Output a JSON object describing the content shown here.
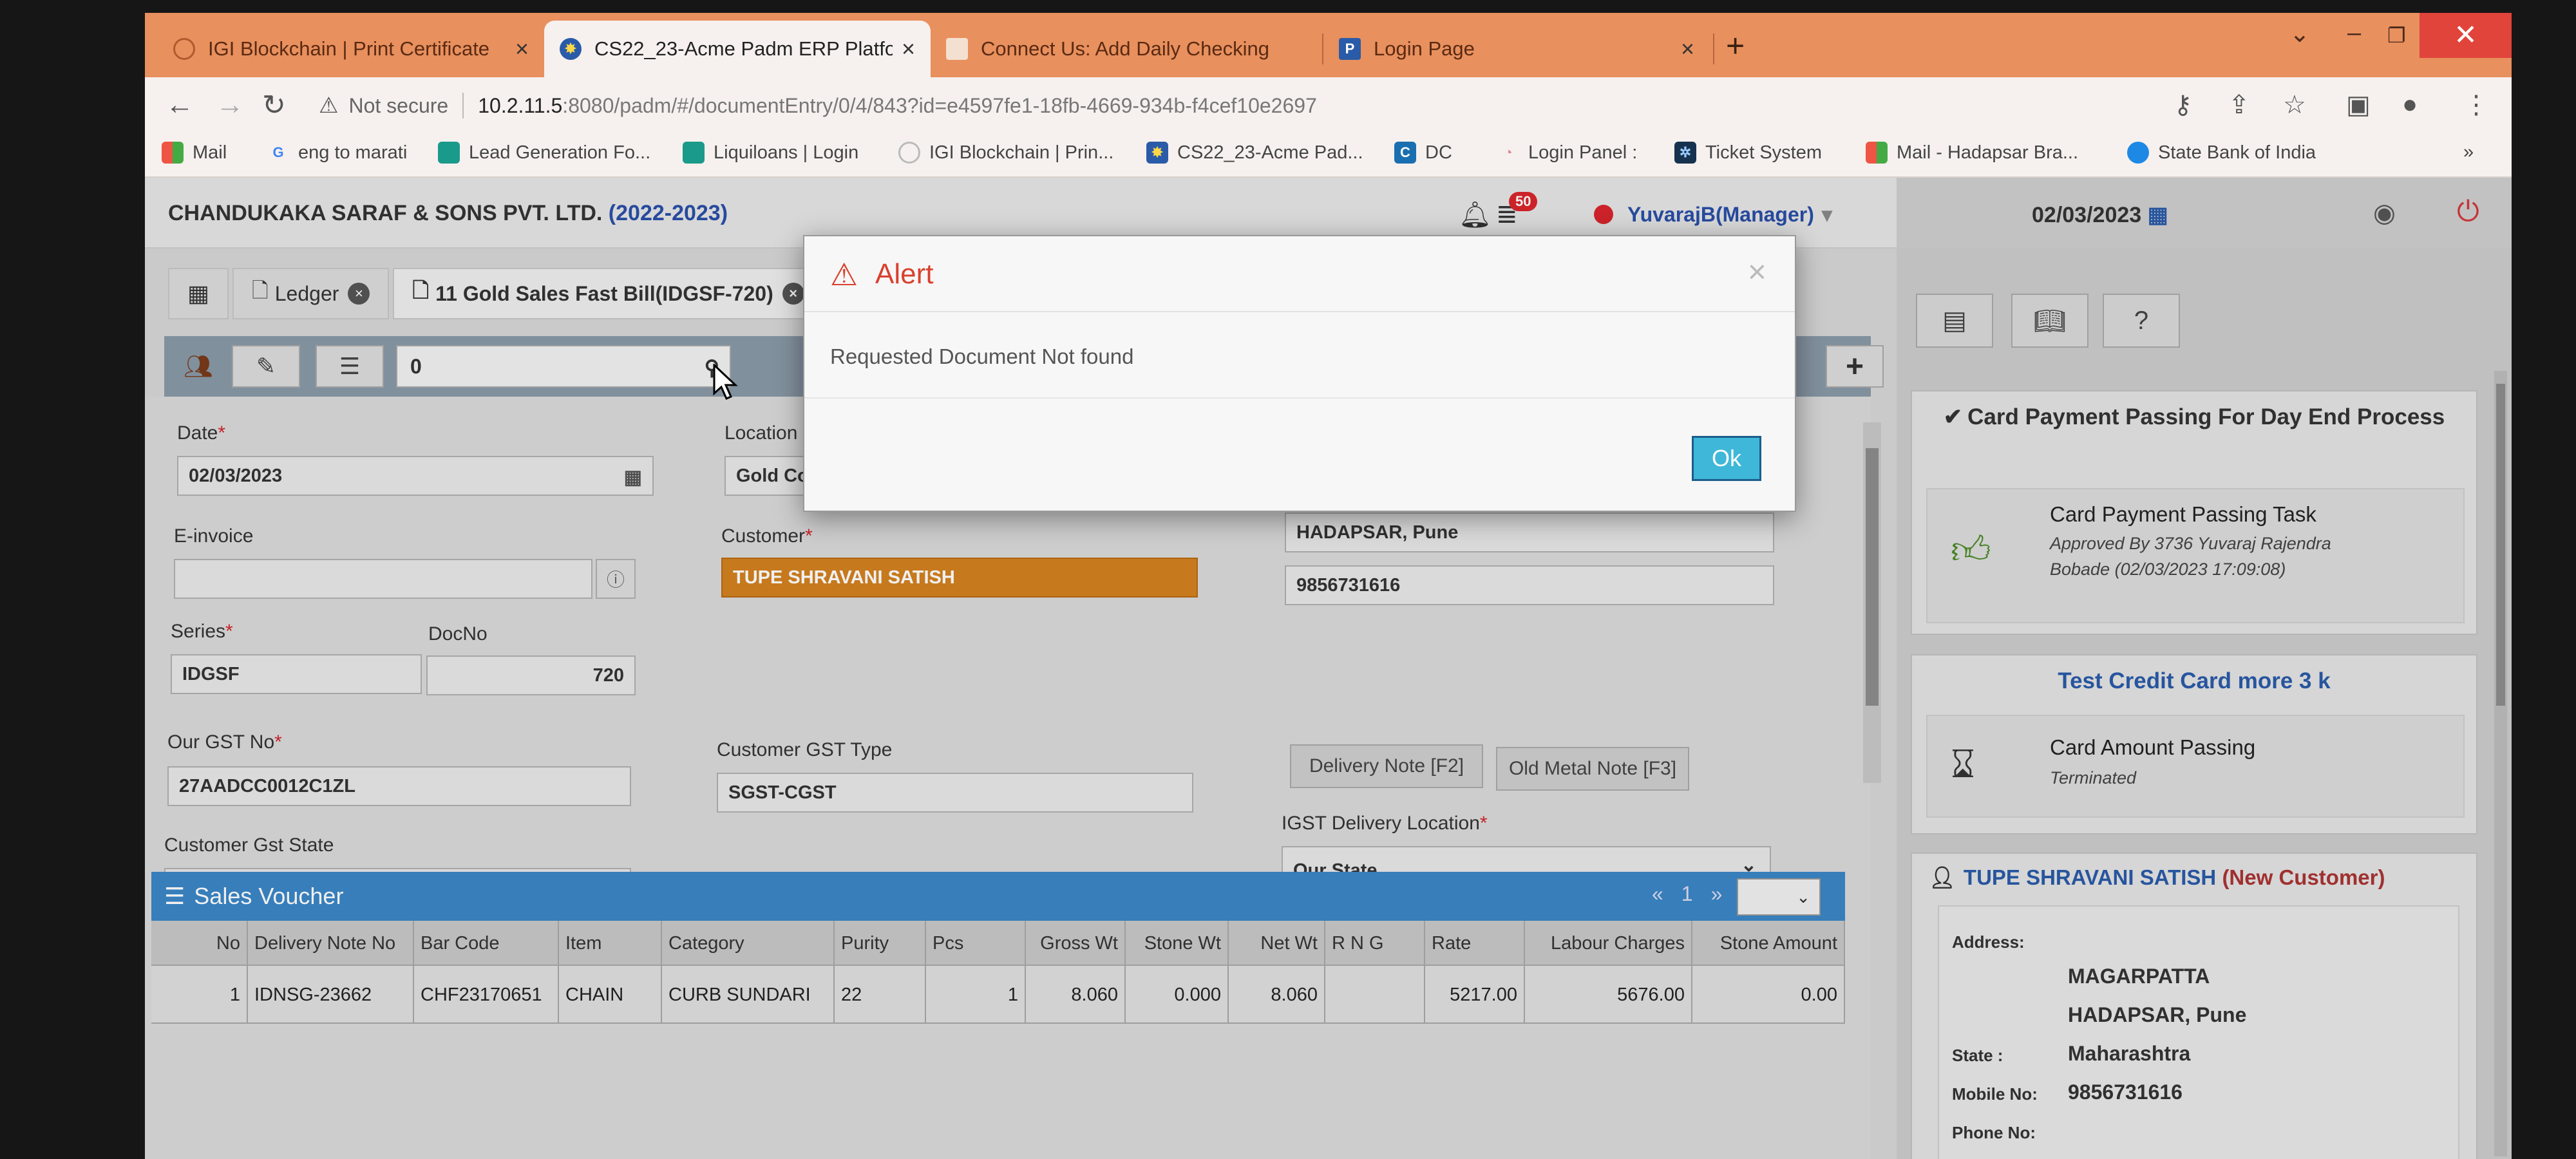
{
  "browser": {
    "tabs": [
      {
        "title": "IGI Blockchain | Print Certificate"
      },
      {
        "title": "CS22_23-Acme Padm ERP Platfo"
      },
      {
        "title": "Connect Us: Add Daily Checking"
      },
      {
        "title": "Login Page"
      }
    ],
    "new_tab": "+",
    "address": {
      "security": "Not secure",
      "host": "10.2.11.5",
      "path": ":8080/padm/#/documentEntry/0/4/843?id=e4597fe1-18fb-4669-934b-f4cef10e2697"
    },
    "bookmarks": [
      "Mail",
      "eng to marati",
      "Lead Generation Fo...",
      "Liquiloans | Login",
      "IGI Blockchain | Prin...",
      "CS22_23-Acme Pad...",
      "DC",
      "Login Panel :",
      "Ticket System",
      "Mail - Hadapsar Bra...",
      "State Bank of India"
    ]
  },
  "header": {
    "company": "CHANDUKAKA SARAF & SONS PVT. LTD.",
    "year": "(2022-2023)",
    "notifications": "50",
    "user": "YuvarajB(Manager)",
    "date": "02/03/2023"
  },
  "doc_tabs": [
    {
      "label": "Ledger"
    },
    {
      "label": "11 Gold Sales Fast Bill(IDGSF-720)"
    }
  ],
  "toolbar": {
    "search_value": "0"
  },
  "form": {
    "date_label": "Date",
    "date_value": "02/03/2023",
    "location_label": "Location",
    "location_value": "Gold Co",
    "einvoice_label": "E-invoice",
    "einvoice_value": "",
    "customer_label": "Customer",
    "customer_value": "TUPE SHRAVANI SATISH",
    "address_value": "HADAPSAR, Pune",
    "mobile_value": "9856731616",
    "series_label": "Series",
    "series_value": "IDGSF",
    "docno_label": "DocNo",
    "docno_value": "720",
    "gst_label": "Our GST No",
    "gst_value": "27AADCC0012C1ZL",
    "cust_gst_type_label": "Customer GST Type",
    "cust_gst_type_value": "SGST-CGST",
    "delivery_note_btn": "Delivery Note [F2]",
    "old_metal_btn": "Old Metal Note [F3]",
    "igst_label": "IGST Delivery Location",
    "igst_value": "Our State",
    "cust_gst_state_label": "Customer Gst State",
    "cust_gst_state_value": ""
  },
  "sales_voucher": {
    "title": "Sales Voucher",
    "pager": {
      "prev": "«",
      "page": "1",
      "next": "»"
    },
    "columns": [
      "No",
      "Delivery Note No",
      "Bar Code",
      "Item",
      "Category",
      "Purity",
      "Pcs",
      "Gross Wt",
      "Stone Wt",
      "Net Wt",
      "R N G",
      "Rate",
      "Labour Charges",
      "Stone Amount"
    ],
    "rows": [
      [
        "1",
        "IDNSG-23662",
        "CHF23170651",
        "CHAIN",
        "CURB SUNDARI",
        "22",
        "1",
        "8.060",
        "0.000",
        "8.060",
        "",
        "5217.00",
        "5676.00",
        "0.00"
      ]
    ]
  },
  "sidebar": {
    "card1": {
      "title": "Card Payment Passing For Day End Process",
      "task_title": "Card Payment Passing Task",
      "task_sub": "Approved By 3736 Yuvaraj Rajendra Bobade (02/03/2023 17:09:08)"
    },
    "card2": {
      "title": "Test Credit Card more 3 k",
      "task_title": "Card Amount Passing",
      "task_sub": "Terminated"
    },
    "customer": {
      "name": "TUPE SHRAVANI SATISH",
      "tag": "(New Customer)",
      "address_label": "Address:",
      "address_line1": "MAGARPATTA",
      "address_line2": "HADAPSAR, Pune",
      "state_label": "State :",
      "state_value": "Maharashtra",
      "mobile_label": "Mobile No:",
      "mobile_value": "9856731616",
      "phone_label": "Phone No:",
      "phone_value": ""
    }
  },
  "alert": {
    "title": "Alert",
    "message": "Requested Document Not found",
    "ok_label": "Ok",
    "close": "×"
  }
}
